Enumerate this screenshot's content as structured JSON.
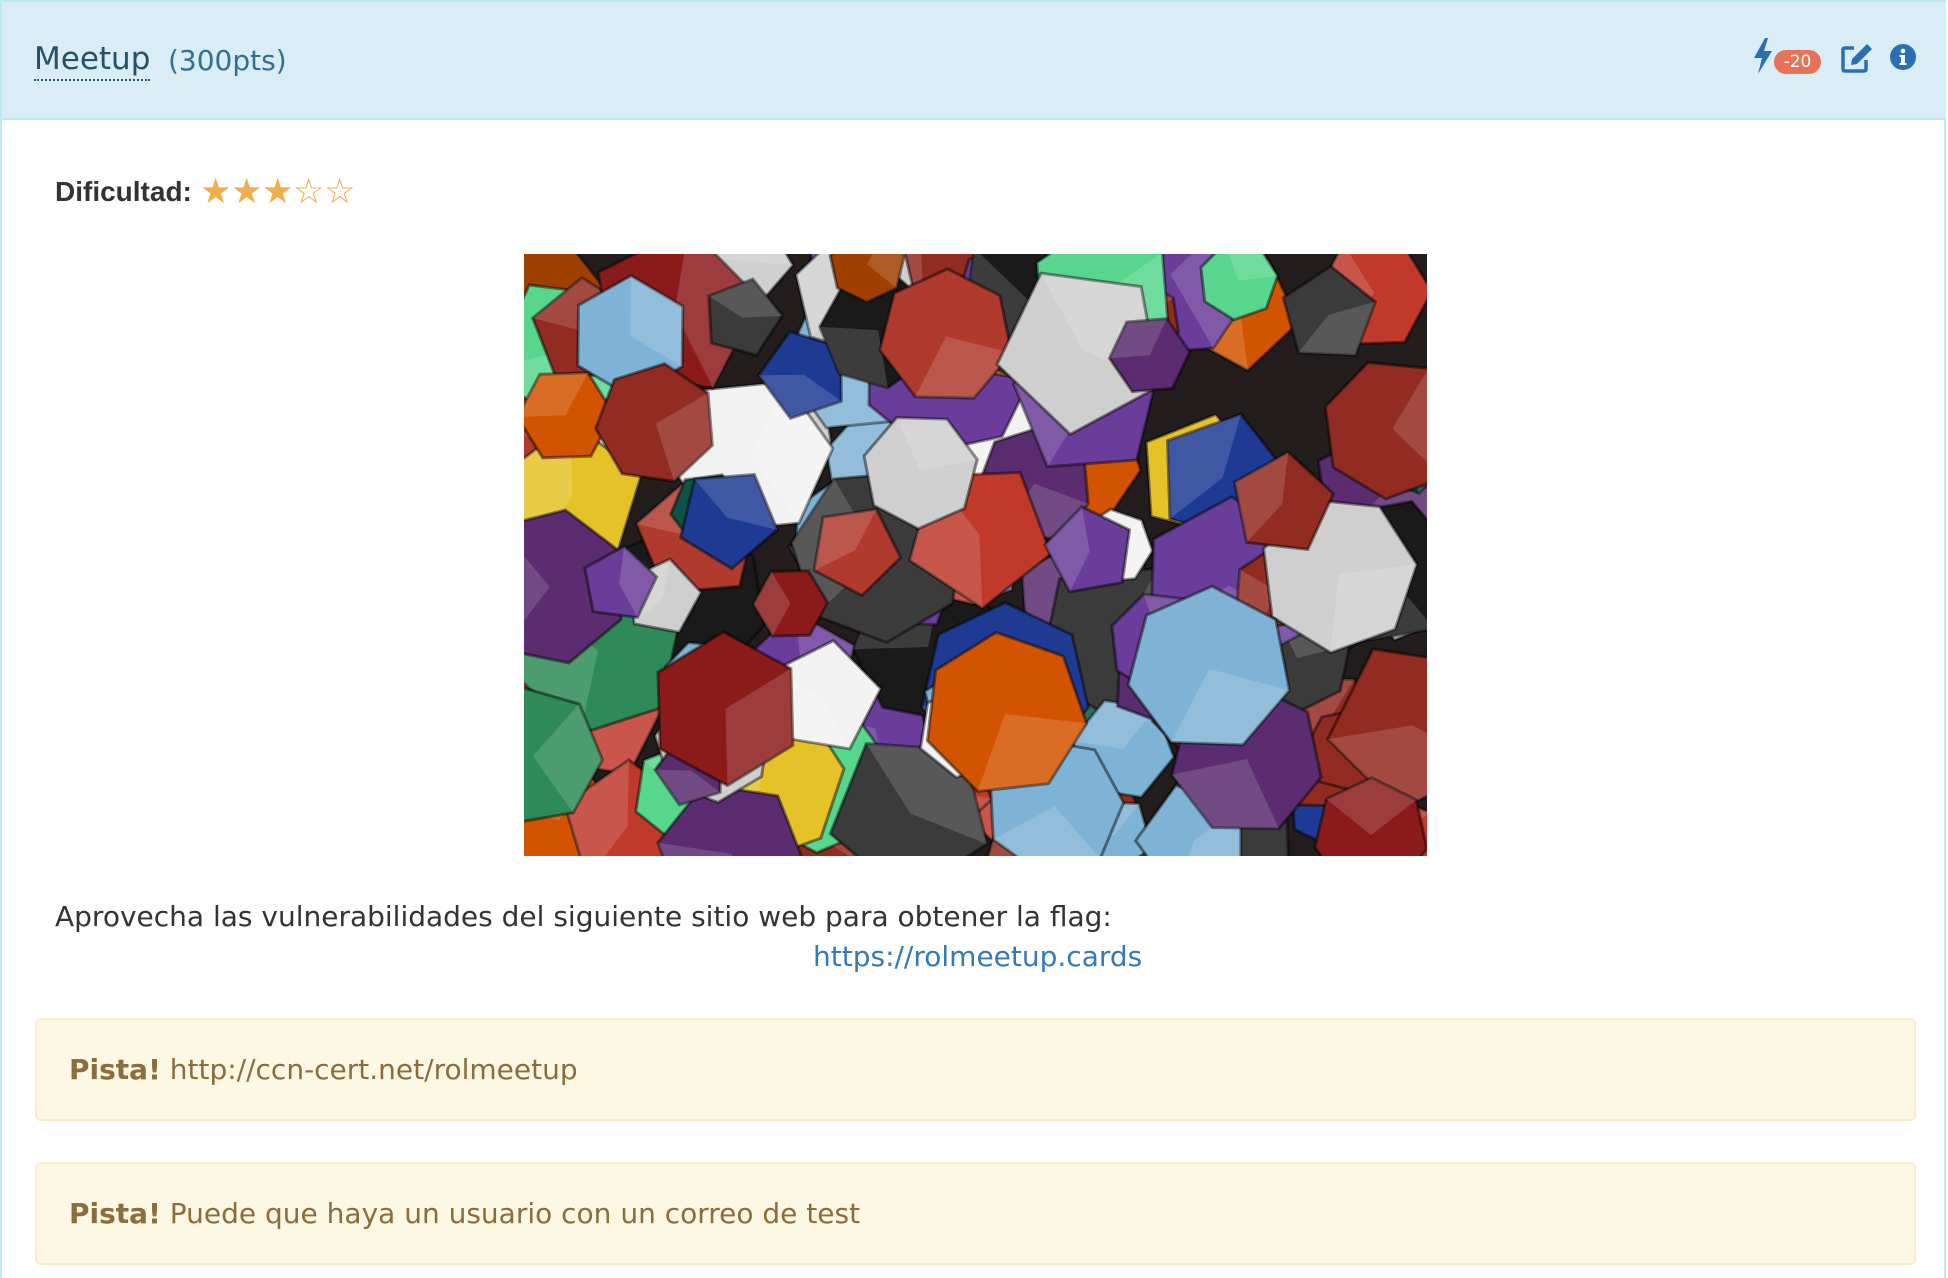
{
  "challenge": {
    "title": "Meetup",
    "points": "(300pts)",
    "badge": "-20"
  },
  "difficulty": {
    "label": "Dificultad:",
    "rating": 3,
    "max": 5
  },
  "description": "Aprovecha las vulnerabilidades del siguiente sitio web para obtener la flag:",
  "link": "https://rolmeetup.cards",
  "hints": [
    {
      "label": "Pista!",
      "text": "http://ccn-cert.net/rolmeetup"
    },
    {
      "label": "Pista!",
      "text": "Puede que haya un usuario con un correo de test"
    }
  ],
  "icons": {
    "bolt": "lightning-bolt-icon",
    "edit": "edit-square-icon",
    "info": "info-circle-icon"
  },
  "colors": {
    "heading_bg": "#d9edf7",
    "panel_border": "#bce8f1",
    "star": "#f0ad4e",
    "badge": "#e8715a",
    "link": "#337ab7",
    "hint_bg": "#fcf8e3",
    "hint_text": "#8a6d3b"
  }
}
